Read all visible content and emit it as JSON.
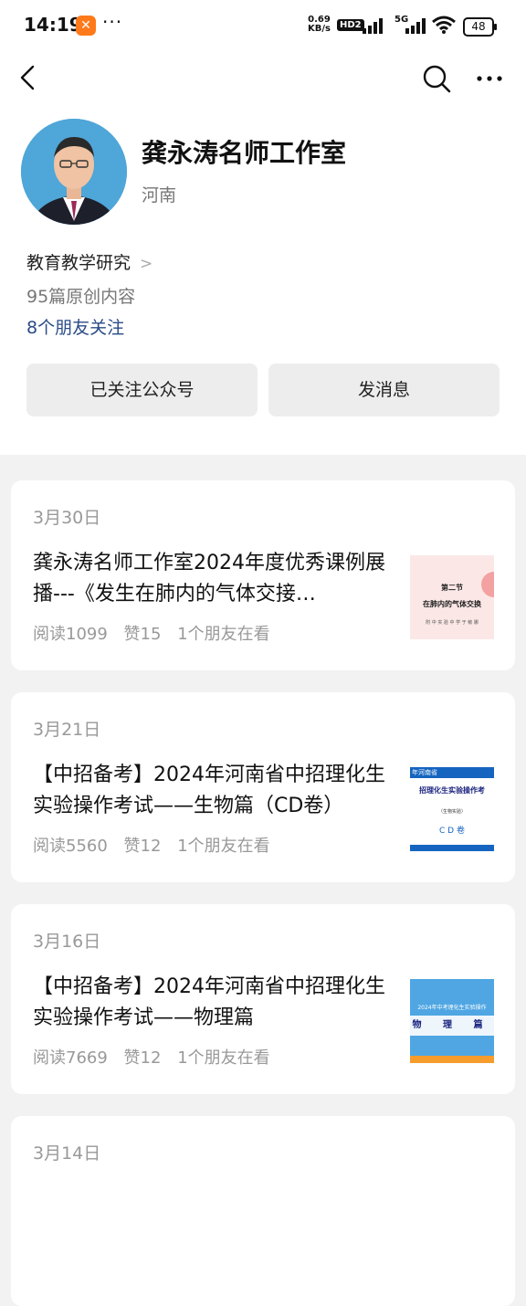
{
  "status_bar": {
    "time": "14:19",
    "more": "···",
    "net_speed": "0.69",
    "net_unit": "KB/s",
    "hd": "HD2",
    "network": "5G",
    "battery": "48"
  },
  "profile": {
    "name": "龚永涛名师工作室",
    "region": "河南",
    "category": "教育教学研究",
    "original_count": "95篇原创内容",
    "friends_following": "8个朋友关注"
  },
  "actions": {
    "follow_label": "已关注公众号",
    "message_label": "发消息"
  },
  "articles": [
    {
      "date": "3月30日",
      "title": "龚永涛名师工作室2024年度优秀课例展播---《发生在肺内的气体交接…",
      "reads": "阅读1099",
      "likes": "赞15",
      "friends": "1个朋友在看",
      "thumb": {
        "line1": "第二节",
        "line2": "在肺内的气体交换",
        "line3": "附 中 实 验 中 学     于 敏 娜"
      }
    },
    {
      "date": "3月21日",
      "title": "【中招备考】2024年河南省中招理化生实验操作考试——生物篇（CD卷）",
      "reads": "阅读5560",
      "likes": "赞12",
      "friends": "1个朋友在看",
      "thumb": {
        "banner": "年河南省",
        "line1": "招理化生实验操作考",
        "line2": "（生物实验）",
        "line3": "C D 卷"
      }
    },
    {
      "date": "3月16日",
      "title": "【中招备考】2024年河南省中招理化生实验操作考试——物理篇",
      "reads": "阅读7669",
      "likes": "赞12",
      "friends": "1个朋友在看",
      "thumb": {
        "line1": "2024年中考理化生实验操作",
        "line2": "物 理 篇"
      }
    },
    {
      "date": "3月14日"
    }
  ],
  "colors": {
    "link": "#2a4b86",
    "muted": "#999999",
    "button_bg": "#ededed"
  }
}
